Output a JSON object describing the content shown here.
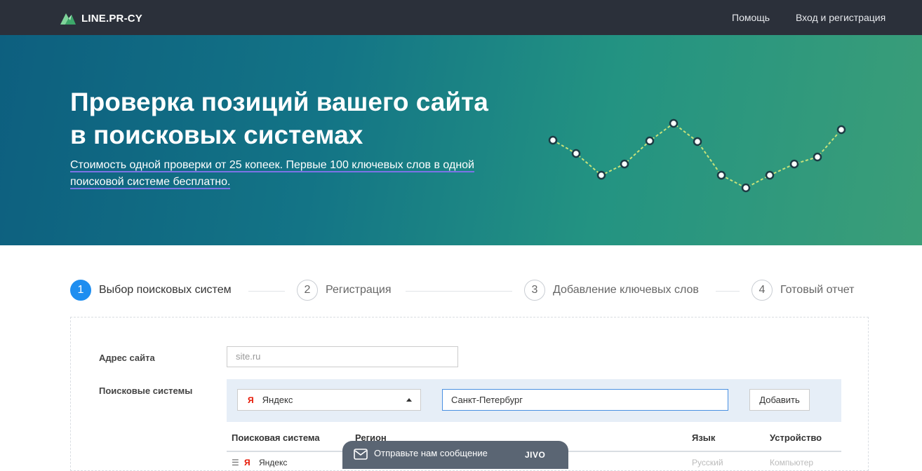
{
  "header": {
    "logo_text": "LINE.PR-CY",
    "help_label": "Помощь",
    "login_label": "Вход и регистрация"
  },
  "hero": {
    "title_line1": "Проверка позиций вашего сайта",
    "title_line2": "в поисковых системах",
    "subtitle": "Стоимость одной проверки от 25 копеек. Первые 100 ключевых слов в одной поисковой системе бесплатно."
  },
  "steps": [
    {
      "number": "1",
      "label": "Выбор поисковых систем",
      "active": true
    },
    {
      "number": "2",
      "label": "Регистрация",
      "active": false
    },
    {
      "number": "3",
      "label": "Добавление ключевых слов",
      "active": false
    },
    {
      "number": "4",
      "label": "Готовый отчет",
      "active": false
    }
  ],
  "form": {
    "site_label": "Адрес сайта",
    "site_placeholder": "site.ru",
    "engines_label": "Поисковые системы",
    "engine_icon": "Я",
    "engine_selected": "Яндекс",
    "region_value": "Санкт-Петербург",
    "add_button": "Добавить"
  },
  "table": {
    "headers": [
      "Поисковая система",
      "Регион",
      "Язык",
      "Устройство"
    ],
    "rows": [
      {
        "engine": "Яндекс",
        "language": "Русский",
        "device": "Компьютер"
      }
    ]
  },
  "chat": {
    "label": "Отправьте нам сообщение",
    "brand": "JIVO"
  },
  "colors": {
    "topbar": "#2b303a",
    "accent": "#1e8ef0",
    "underline": "#7b73e6",
    "chart_line": "#c8e27a"
  }
}
